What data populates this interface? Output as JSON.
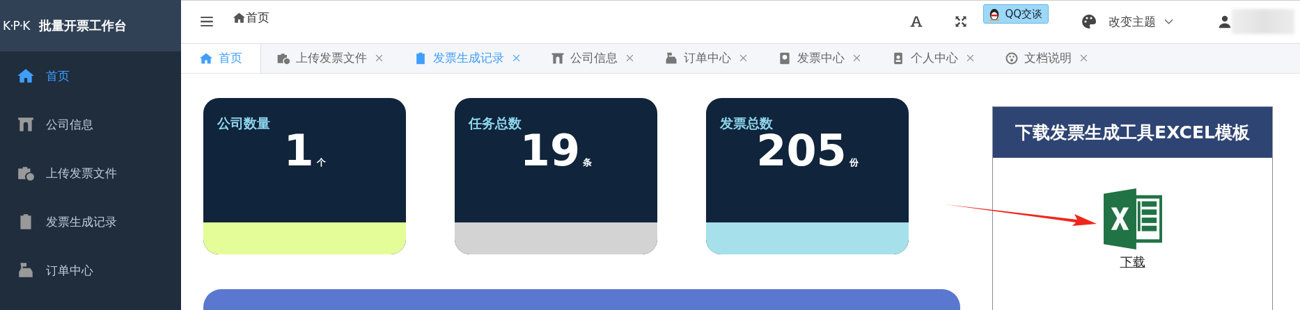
{
  "sidebar": {
    "logo": "K·P·K",
    "title": "批量开票工作台",
    "items": [
      {
        "label": "首页",
        "selected": true
      },
      {
        "label": "公司信息",
        "selected": false
      },
      {
        "label": "上传发票文件",
        "selected": false
      },
      {
        "label": "发票生成记录",
        "selected": false
      },
      {
        "label": "订单中心",
        "selected": false
      }
    ]
  },
  "header": {
    "breadcrumb": "首页",
    "qq_button": "QQ交谈",
    "theme": "改变主题"
  },
  "tabs": [
    {
      "label": "首页",
      "selected": true,
      "closable": false,
      "highlighted": false
    },
    {
      "label": "上传发票文件",
      "selected": false,
      "closable": true,
      "highlighted": false
    },
    {
      "label": "发票生成记录",
      "selected": false,
      "closable": true,
      "highlighted": true
    },
    {
      "label": "公司信息",
      "selected": false,
      "closable": true,
      "highlighted": false
    },
    {
      "label": "订单中心",
      "selected": false,
      "closable": true,
      "highlighted": false
    },
    {
      "label": "发票中心",
      "selected": false,
      "closable": true,
      "highlighted": false
    },
    {
      "label": "个人中心",
      "selected": false,
      "closable": true,
      "highlighted": false
    },
    {
      "label": "文档说明",
      "selected": false,
      "closable": true,
      "highlighted": false
    }
  ],
  "stats": [
    {
      "title": "公司数量",
      "value": "1",
      "unit": "个",
      "color": "#e4fd98"
    },
    {
      "title": "任务总数",
      "value": "19",
      "unit": "条",
      "color": "#d3d3d3"
    },
    {
      "title": "发票总数",
      "value": "205",
      "unit": "份",
      "color": "#a6e0ea"
    }
  ],
  "download_panel": {
    "title": "下载发票生成工具EXCEL模板",
    "link": "下载"
  }
}
